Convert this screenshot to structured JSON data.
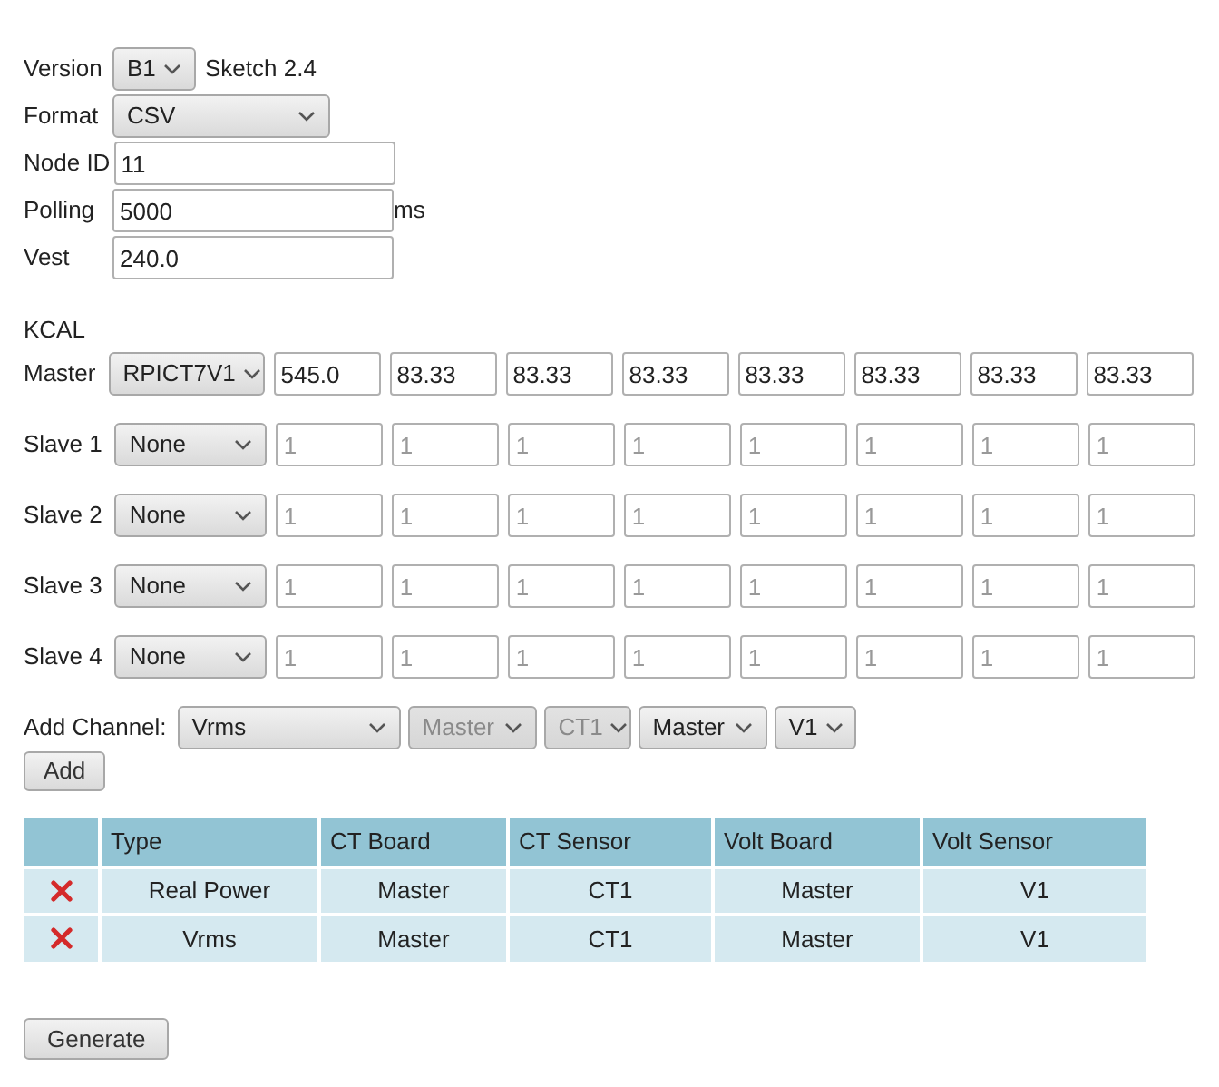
{
  "version": {
    "label": "Version",
    "value": "B1",
    "note": "Sketch 2.4"
  },
  "format": {
    "label": "Format",
    "value": "CSV"
  },
  "node_id": {
    "label": "Node ID",
    "value": "11"
  },
  "polling": {
    "label": "Polling",
    "value": "5000",
    "unit": "ms"
  },
  "vest": {
    "label": "Vest",
    "value": "240.0"
  },
  "kcal": {
    "title": "KCAL",
    "boards": [
      {
        "label": "Master",
        "board": "RPICT7V1",
        "fields": [
          {
            "value": "545.0"
          },
          {
            "value": "83.33"
          },
          {
            "value": "83.33"
          },
          {
            "value": "83.33"
          },
          {
            "value": "83.33"
          },
          {
            "value": "83.33"
          },
          {
            "value": "83.33"
          },
          {
            "value": "83.33"
          }
        ]
      },
      {
        "label": "Slave 1",
        "board": "None",
        "fields": [
          {
            "placeholder": "1"
          },
          {
            "placeholder": "1"
          },
          {
            "placeholder": "1"
          },
          {
            "placeholder": "1"
          },
          {
            "placeholder": "1"
          },
          {
            "placeholder": "1"
          },
          {
            "placeholder": "1"
          },
          {
            "placeholder": "1"
          }
        ]
      },
      {
        "label": "Slave 2",
        "board": "None",
        "fields": [
          {
            "placeholder": "1"
          },
          {
            "placeholder": "1"
          },
          {
            "placeholder": "1"
          },
          {
            "placeholder": "1"
          },
          {
            "placeholder": "1"
          },
          {
            "placeholder": "1"
          },
          {
            "placeholder": "1"
          },
          {
            "placeholder": "1"
          }
        ]
      },
      {
        "label": "Slave 3",
        "board": "None",
        "fields": [
          {
            "placeholder": "1"
          },
          {
            "placeholder": "1"
          },
          {
            "placeholder": "1"
          },
          {
            "placeholder": "1"
          },
          {
            "placeholder": "1"
          },
          {
            "placeholder": "1"
          },
          {
            "placeholder": "1"
          },
          {
            "placeholder": "1"
          }
        ]
      },
      {
        "label": "Slave 4",
        "board": "None",
        "fields": [
          {
            "placeholder": "1"
          },
          {
            "placeholder": "1"
          },
          {
            "placeholder": "1"
          },
          {
            "placeholder": "1"
          },
          {
            "placeholder": "1"
          },
          {
            "placeholder": "1"
          },
          {
            "placeholder": "1"
          },
          {
            "placeholder": "1"
          }
        ]
      }
    ]
  },
  "add_channel": {
    "label": "Add Channel:",
    "selects": [
      {
        "value": "Vrms",
        "disabled": false
      },
      {
        "value": "Master",
        "disabled": true
      },
      {
        "value": "CT1",
        "disabled": true
      },
      {
        "value": "Master",
        "disabled": false
      },
      {
        "value": "V1",
        "disabled": false
      }
    ],
    "button": "Add"
  },
  "table": {
    "columns": [
      "Type",
      "CT Board",
      "CT Sensor",
      "Volt Board",
      "Volt Sensor"
    ],
    "rows": [
      [
        "Real Power",
        "Master",
        "CT1",
        "Master",
        "V1"
      ],
      [
        "Vrms",
        "Master",
        "CT1",
        "Master",
        "V1"
      ]
    ]
  },
  "generate_button": "Generate"
}
